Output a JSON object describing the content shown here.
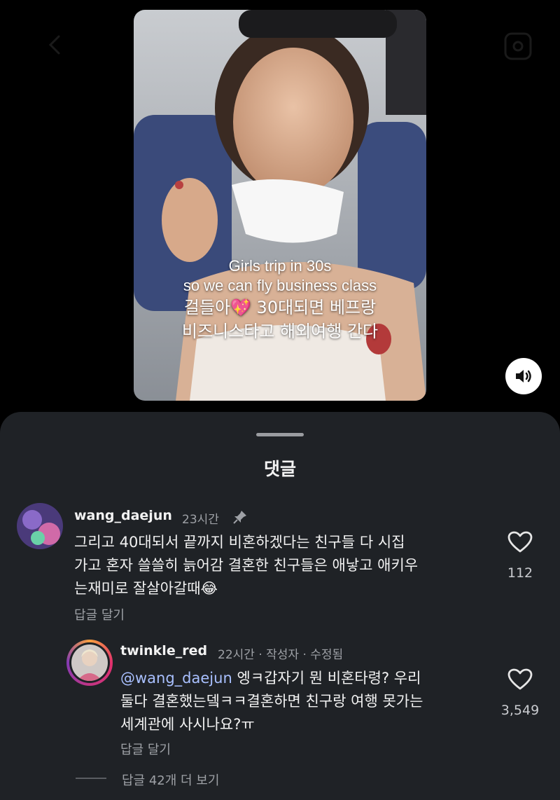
{
  "video": {
    "caption_en_1": "Girls trip in 30s",
    "caption_en_2": "so we can fly business class",
    "caption_ko_1": "걸들아💖 30대되면 베프랑",
    "caption_ko_2": "비즈니스타고 해외여행 간다"
  },
  "sheet": {
    "title": "댓글"
  },
  "comments": [
    {
      "username": "wang_daejun",
      "time": "23시간",
      "text_lines": [
        "그리고 40대되서 끝까지 비혼하겠다는 친구들 다 시집",
        "가고 혼자 쓸쓸히 늙어감 결혼한 친구들은 애낳고 애키우",
        "는재미로 잘살아갈때😂"
      ],
      "reply_label": "답글 달기",
      "likes": "112"
    },
    {
      "username": "twinkle_red",
      "time": "22시간 · 작성자 · 수정됨",
      "mention": "@wang_daejun",
      "text_line1_rest": " 엥ㅋ갑자기 뭔 비혼타령? 우리",
      "text_lines": [
        "둘다 결혼했는뎈ㅋㅋ결혼하면 친구랑 여행 못가는",
        "세계관에 사시나요?ㅠ"
      ],
      "reply_label": "답글 달기",
      "likes": "3,549"
    }
  ],
  "more_replies": "답글 42개 더 보기",
  "icons": {
    "back": "chevron-left-icon",
    "more": "more-icon",
    "sound": "speaker-icon",
    "pin": "pin-icon",
    "like": "heart-icon"
  },
  "colors": {
    "sheet_bg": "#1f2226",
    "mention": "#a9c0ff",
    "muted": "#9ea1a6"
  }
}
